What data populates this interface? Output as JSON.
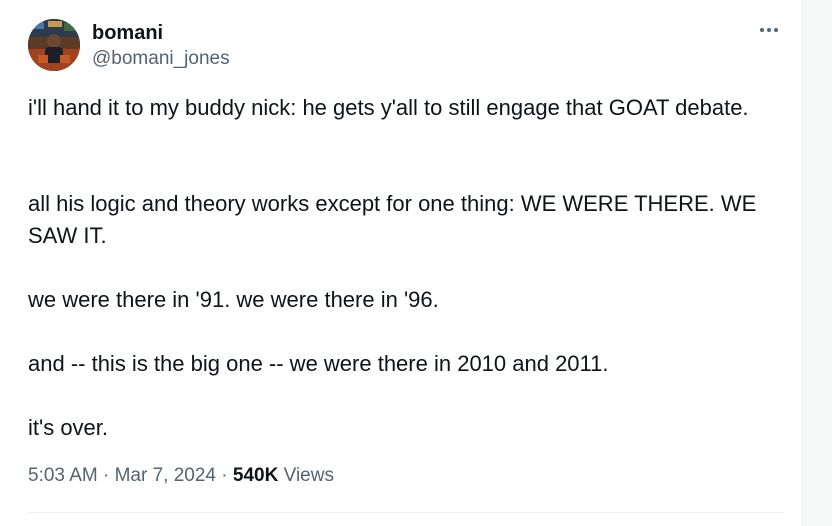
{
  "author": {
    "display_name": "bomani",
    "handle": "@bomani_jones"
  },
  "tweet": {
    "paragraphs": [
      "i'll hand it to my buddy nick: he gets y'all to still engage that GOAT debate.",
      "all his logic and theory works except for one thing: WE WERE THERE. WE SAW IT.",
      "we were there in '91. we were there in '96.",
      "and -- this is the big one -- we were there in 2010 and 2011.",
      "it's over."
    ]
  },
  "meta": {
    "time": "5:03 AM",
    "separator": "·",
    "date": "Mar 7, 2024",
    "views_count": "540K",
    "views_label": "Views"
  },
  "icons": {
    "more": "more-options-icon"
  },
  "colors": {
    "text_primary": "#0f1419",
    "text_secondary": "#536471",
    "background": "#ffffff",
    "page_background": "#f7f9f9",
    "divider": "#eff3f4"
  }
}
